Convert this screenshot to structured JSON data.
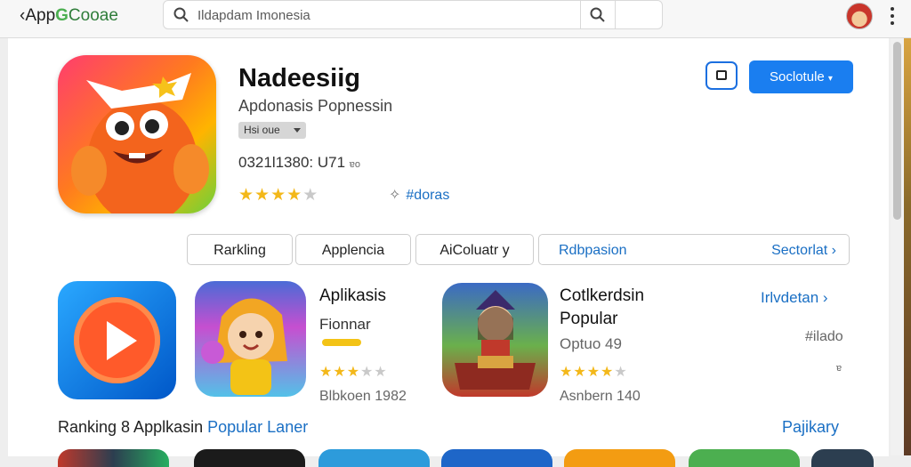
{
  "topbar": {
    "logo": {
      "part1": "‹App",
      "part2": "G",
      "part3": "Cooae"
    },
    "search": {
      "value": "Ildapdam Imonesia"
    },
    "icons": {
      "search": "search-icon",
      "search_button": "search-icon",
      "avatar": "avatar",
      "more": "kebab-icon"
    }
  },
  "app": {
    "title": "Nadeesiig",
    "subtitle": "Apdonasis Popnessin",
    "age_badge": "Hsi oue",
    "meta_main": "0321l1380: U71",
    "meta_small": "ɐo",
    "rating": 4,
    "rating_max": 5,
    "tagline": "#doras",
    "bookmark_icon": "bookmark-icon",
    "primary_button": "Soclotule",
    "primary_caret": "▾"
  },
  "tabs": {
    "ranking": "Rarkling",
    "applications": "Applencia",
    "activity": "AiColuatr y",
    "wide_left": "Rdbpasion",
    "wide_right": "Sectorlat ›"
  },
  "featured": {
    "app1": {
      "title": "Aplikasis",
      "subtitle": "Fionnar",
      "rating": 3,
      "count": "Blbkoen 1982"
    },
    "app2": {
      "title_line1": "Cotlkerdsin",
      "title_line2": "Popular",
      "subtitle": "Optuo 49",
      "rating": 4,
      "count": "Asnbern 140"
    },
    "side": {
      "link": "Irlvdetan ›",
      "tag": "#ilado",
      "small": "ɐ"
    }
  },
  "section": {
    "part1": "Ranking 8 Applkasin",
    "part2": "Popular Laner",
    "link": "Pajikary"
  },
  "colors": {
    "accent": "#1a7ef0",
    "link": "#1a6fc4",
    "star": "#f3b81a"
  }
}
